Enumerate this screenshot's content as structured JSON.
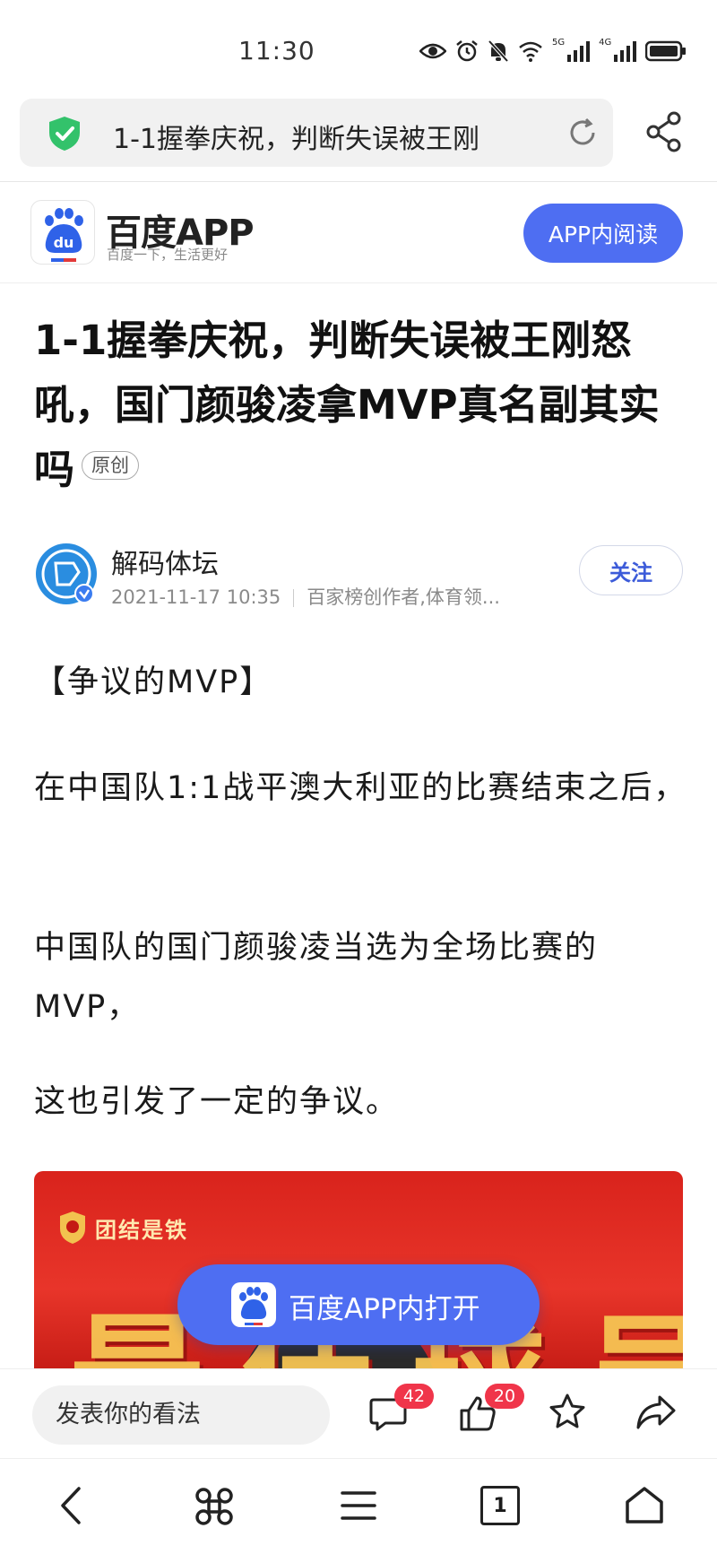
{
  "status_bar": {
    "time": "11:30",
    "net1": "5G",
    "net2": "4G",
    "icons": [
      "eye-icon",
      "alarm-icon",
      "mute-bell-icon",
      "wifi-icon",
      "signal-5g-icon",
      "signal-4g-icon",
      "battery-icon"
    ]
  },
  "url_bar": {
    "title": "1-1握拳庆祝，判断失误被王刚",
    "security_icon": "shield-check-icon",
    "reload_icon": "reload-icon",
    "share_icon": "share-icon"
  },
  "app_header": {
    "name": "百度APP",
    "slogan": "百度一下，生活更好",
    "read_button": "APP内阅读",
    "brand_color": "#4e6ef2"
  },
  "article": {
    "title": "1-1握拳庆祝，判断失误被王刚怒吼，国门颜骏凌拿MVP真名副其实吗",
    "original_tag": "原创",
    "author": {
      "name": "解码体坛",
      "date": "2021-11-17 10:35",
      "description": "百家榜创作者,体育领..."
    },
    "follow_button": "关注",
    "paragraphs": [
      "【争议的MVP】",
      "在中国队1:1战平澳大利亚的比赛结束之后，",
      "中国队的国门颜骏凌当选为全场比赛的MVP，",
      "这也引发了一定的争议。"
    ],
    "image": {
      "caption": "团结是铁",
      "big_text": "最佳球员"
    }
  },
  "open_in_app": {
    "label": "百度APP内打开"
  },
  "comment_bar": {
    "placeholder": "发表你的看法",
    "comment_count": "42",
    "like_count": "20",
    "icons": [
      "comment-icon",
      "like-icon",
      "star-icon",
      "forward-icon"
    ]
  },
  "nav_bar": {
    "tab_count": "1",
    "icons": [
      "back-icon",
      "apps-icon",
      "menu-icon",
      "tabs-icon",
      "home-icon"
    ]
  }
}
